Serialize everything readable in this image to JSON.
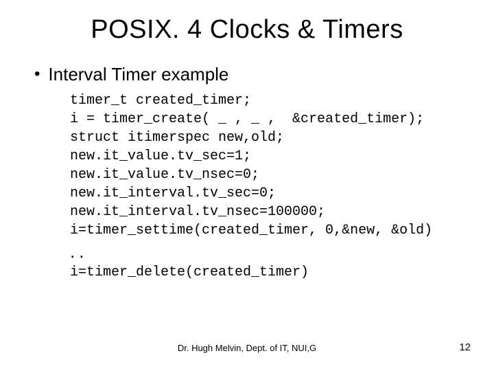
{
  "title": "POSIX. 4 Clocks & Timers",
  "bullet": "Interval Timer example",
  "code1": "timer_t created_timer;\ni = timer_create( _ , _ ,  &created_timer);\nstruct itimerspec new,old;\nnew.it_value.tv_sec=1;\nnew.it_value.tv_nsec=0;\nnew.it_interval.tv_sec=0;\nnew.it_interval.tv_nsec=100000;\ni=timer_settime(created_timer, 0,&new, &old)",
  "dots": "..",
  "code2": "i=timer_delete(created_timer)",
  "footer": "Dr. Hugh Melvin, Dept. of IT, NUI,G",
  "pagenum": "12"
}
